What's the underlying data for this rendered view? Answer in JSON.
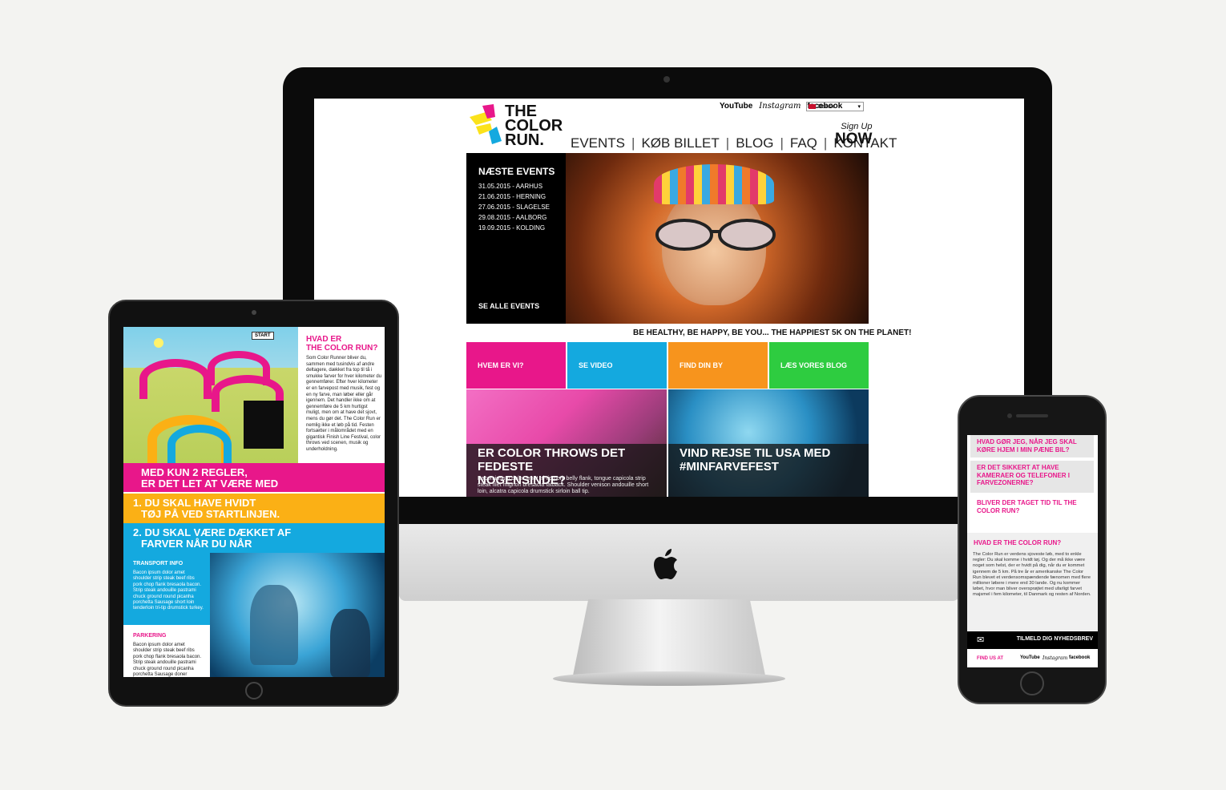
{
  "desktop": {
    "logo": {
      "line1": "THE",
      "line2": "COLOR",
      "line3": "RUN."
    },
    "social": [
      "YouTube",
      "Instagram",
      "facebook"
    ],
    "language": "Dansk",
    "nav": [
      "EVENTS",
      "KØB BILLET",
      "BLOG",
      "FAQ",
      "KONTAKT"
    ],
    "nav_sep": "|",
    "signup": {
      "top": "Sign Up",
      "bottom": "NOW"
    },
    "events_panel": {
      "title": "NÆSTE EVENTS",
      "items": [
        "31.05.2015 - AARHUS",
        "21.06.2015 - HERNING",
        "27.06.2015 - SLAGELSE",
        "29.08.2015 - AALBORG",
        "19.09.2015 - KOLDING"
      ],
      "see_all": "SE ALLE EVENTS"
    },
    "tagline": "BE HEALTHY, BE HAPPY, BE YOU... THE HAPPIEST 5K ON THE PLANET!",
    "tiles": [
      {
        "label": "HVEM ER VI?",
        "color": "#e8178a"
      },
      {
        "label": "SE VIDEO",
        "color": "#14a9df"
      },
      {
        "label": "FIND DIN BY",
        "color": "#f7941d"
      },
      {
        "label": "LÆS VORES BLOG",
        "color": "#2ecc40"
      }
    ],
    "features": [
      {
        "title_1": "ER COLOR THROWS DET FEDESTE",
        "title_2": "NOGENSINDE?",
        "body": "Bacon ipsum dolor amet tri-tip pork belly flank, tongue capicola strip steak filet mignon bresaola fatback. Shoulder venison andouille short loin, alcatra capicola drumstick sirloin ball tip."
      },
      {
        "title_1": "VIND REJSE TIL USA MED",
        "title_2": "#MINFARVEFEST",
        "body": ""
      }
    ]
  },
  "tablet": {
    "question_1": "HVAD ER",
    "question_2": "THE COLOR RUN?",
    "intro": "Som Color Runner bliver du, sammen med tusindvis af andre deltagere, dækket fra top til tå i smukke farver for hver kilometer du gennemfører. Efter hver kilometer er en farvepost med musik, fest og en ny farve, man løber eller går igennem. Det handler ikke om at gennemføre de 5 km hurtigst muligt, men om at have det sjovt, mens du gør det. The Color Run er nemlig ikke et løb på tid. Festen fortsætter i målområdet med en gigantisk Finish Line Festival, color throws ved scenen, musik og underholdning.",
    "map_sign": "START",
    "bands": [
      {
        "line1": "MED KUN 2 REGLER,",
        "line2": "ER DET LET AT VÆRE MED",
        "color": "#e8178a"
      },
      {
        "line1": "1. DU SKAL HAVE HVIDT",
        "line2": "TØJ PÅ VED STARTLINJEN.",
        "color": "#fbb015"
      },
      {
        "line1": "2. DU SKAL VÆRE DÆKKET AF",
        "line2": "FARVER NÅR DU NÅR",
        "color": "#14a9df"
      }
    ],
    "transport": {
      "title": "TRANSPORT INFO",
      "body": "Bacon ipsum dolor amet shoulder strip steak beef ribs pork chop flank bresaola bacon. Strip steak andouille pastrami chuck ground round picanha porchetta Sausage short loin tenderloin tri-tip drumstick turkey."
    },
    "parking": {
      "title": "PARKERING",
      "body": "Bacon ipsum dolor amet shoulder strip steak beef ribs pork chop flank bresaola bacon. Strip steak andouille pastrami chuck ground round picanha porchetta Sausage doner meatball shoulder."
    }
  },
  "phone": {
    "faqs": [
      "HVAD GØR JEG, NÅR JEG SKAL KØRE HJEM I MIN PÆNE BIL?",
      "ER DET SIKKERT AT HAVE KAMERAER OG TELEFONER I FARVEZONERNE?",
      "BLIVER DER TAGET TID TIL THE COLOR RUN?"
    ],
    "what_title": "HVAD ER THE COLOR RUN?",
    "what_body": "The Color Run er verdens sjoveste løb, med to enkle regler: Du skal komme i hvidt tøj. Og der må ikke være noget som helst, der er hvidt på dig, når du er kommet igennem de 5 km. På tre år er amerikanske The Color Run blevet et verdensomspændende fænomen med flere millioner løbere i mere end 30 lande. Og nu kommer løbet, hvor man bliver oversprøjtet med ufarligt farvet majsmel i fem kilometer, til Danmark og resten af Norden.",
    "newsletter": "TILMELD DIG NYHEDSBREV",
    "find_us": "FIND US AT",
    "social": [
      "YouTube",
      "Instagram",
      "facebook"
    ]
  },
  "colors": {
    "pink": "#e8178a",
    "blue": "#14a9df",
    "orange": "#f7941d",
    "yellow": "#fbb015",
    "green": "#2ecc40"
  }
}
